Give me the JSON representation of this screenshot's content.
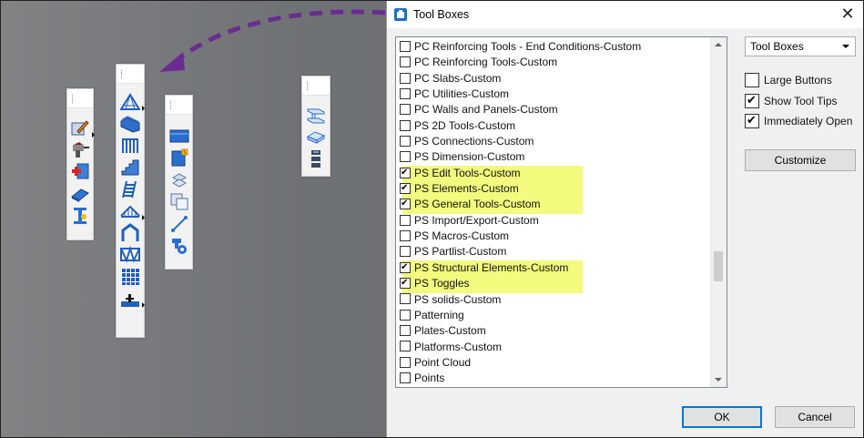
{
  "dialog": {
    "title": "Tool Boxes",
    "close_glyph": "✕",
    "items": [
      {
        "label": "PC Reinforcing Tools - End Conditions-Custom",
        "checked": false
      },
      {
        "label": "PC Reinforcing Tools-Custom",
        "checked": false
      },
      {
        "label": "PC Slabs-Custom",
        "checked": false
      },
      {
        "label": "PC Utilities-Custom",
        "checked": false
      },
      {
        "label": "PC Walls and Panels-Custom",
        "checked": false
      },
      {
        "label": "PS 2D Tools-Custom",
        "checked": false
      },
      {
        "label": "PS Connections-Custom",
        "checked": false
      },
      {
        "label": "PS Dimension-Custom",
        "checked": false
      },
      {
        "label": "PS Edit Tools-Custom",
        "checked": true
      },
      {
        "label": "PS Elements-Custom",
        "checked": true
      },
      {
        "label": "PS General Tools-Custom",
        "checked": true
      },
      {
        "label": "PS Import/Export-Custom",
        "checked": false
      },
      {
        "label": "PS Macros-Custom",
        "checked": false
      },
      {
        "label": "PS Partlist-Custom",
        "checked": false
      },
      {
        "label": "PS Structural Elements-Custom",
        "checked": true
      },
      {
        "label": "PS Toggles",
        "checked": true
      },
      {
        "label": "PS solids-Custom",
        "checked": false
      },
      {
        "label": "Patterning",
        "checked": false
      },
      {
        "label": "Plates-Custom",
        "checked": false
      },
      {
        "label": "Platforms-Custom",
        "checked": false
      },
      {
        "label": "Point Cloud",
        "checked": false
      },
      {
        "label": "Points",
        "checked": false
      }
    ],
    "dropdown_value": "Tool Boxes",
    "options": {
      "large_buttons": {
        "label": "Large Buttons",
        "checked": false
      },
      "show_tool_tips": {
        "label": "Show Tool Tips",
        "checked": true
      },
      "immediately_open": {
        "label": "Immediately Open",
        "checked": true
      }
    },
    "customize_label": "Customize",
    "ok_label": "OK",
    "cancel_label": "Cancel"
  },
  "colors": {
    "highlight": "#f3fa7d",
    "arrow": "#6b2c91",
    "icon_blue": "#1f5fbf"
  },
  "toolboxes": {
    "box1": [
      "edit-element-icon",
      "drill-icon",
      "insert-element-icon",
      "plate-icon",
      "column-icon"
    ],
    "box2": [
      "roof-truss-icon",
      "corrugated-sheet-icon",
      "railing-icon",
      "stairs-icon",
      "ladder-icon",
      "bridge-truss-icon",
      "portal-frame-icon",
      "bracing-icon",
      "grating-icon",
      "platform-icon"
    ],
    "box3": [
      "beam-profile-icon",
      "edit-profile-icon",
      "move-icon",
      "copy-icon",
      "line-icon",
      "settings-icon"
    ],
    "box4": [
      "i-beam-icon",
      "plate-3d-icon",
      "bolt-stack-icon"
    ]
  }
}
